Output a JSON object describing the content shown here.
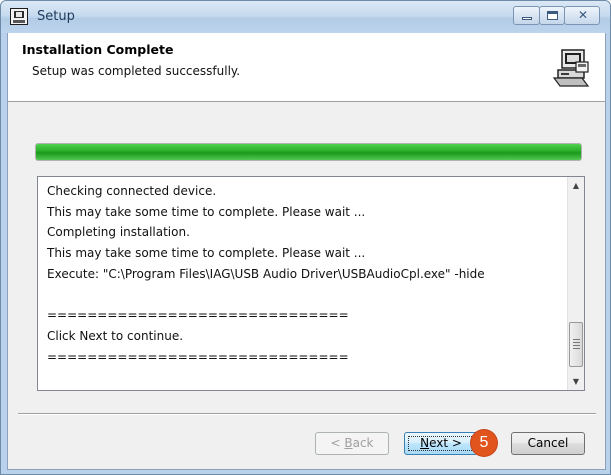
{
  "window": {
    "title": "Setup",
    "icon": "setup-app-icon",
    "controls": [
      "minimize-icon",
      "maximize-icon",
      "close-icon"
    ]
  },
  "header": {
    "title": "Installation Complete",
    "subtitle": "Setup was completed successfully.",
    "icon": "installer-computer-icon"
  },
  "progress": {
    "value": 1.0,
    "color": "#2fb22f"
  },
  "log": {
    "lines": [
      "Checking connected device.",
      "This may take some time to complete. Please wait ...",
      "Completing installation.",
      "This may take some time to complete. Please wait ...",
      "Execute: \"C:\\Program Files\\IAG\\USB Audio Driver\\USBAudioCpl.exe\" -hide",
      "",
      "==============================",
      "Click Next to continue.",
      "=============================="
    ]
  },
  "buttons": {
    "back_label_pre": "< ",
    "back_label_key": "B",
    "back_label_post": "ack",
    "next_label_key": "N",
    "next_label_post": "ext >",
    "cancel_label": "Cancel"
  },
  "annotation": {
    "step_number": "5",
    "color": "#e2541d"
  }
}
